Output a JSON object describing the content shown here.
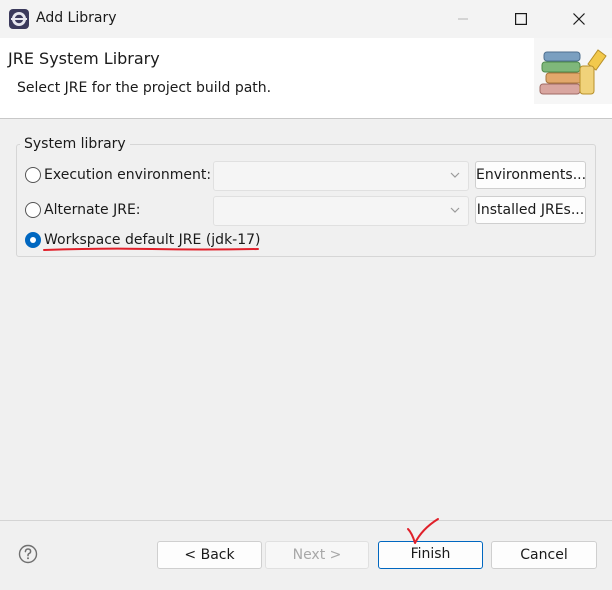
{
  "window": {
    "title": "Add Library"
  },
  "icons": {
    "app": "eclipse-icon",
    "minimize": "minimize-icon",
    "maximize": "maximize-icon",
    "close": "close-icon",
    "banner": "library-books-icon",
    "help": "help-icon",
    "dropdown": "chevron-down-icon"
  },
  "header": {
    "title": "JRE System Library",
    "subtitle": "Select JRE for the project build path."
  },
  "system_library": {
    "legend": "System library",
    "options": [
      {
        "label": "Execution environment:",
        "selected": false,
        "value": "",
        "button": "Environments..."
      },
      {
        "label": "Alternate JRE:",
        "selected": false,
        "value": "",
        "button": "Installed JREs..."
      },
      {
        "label": "Workspace default JRE (jdk-17)",
        "selected": true
      }
    ]
  },
  "footer": {
    "back": "< Back",
    "next": "Next >",
    "finish": "Finish",
    "cancel": "Cancel"
  },
  "colors": {
    "accent": "#0067c0",
    "annotation": "#e0202a"
  }
}
